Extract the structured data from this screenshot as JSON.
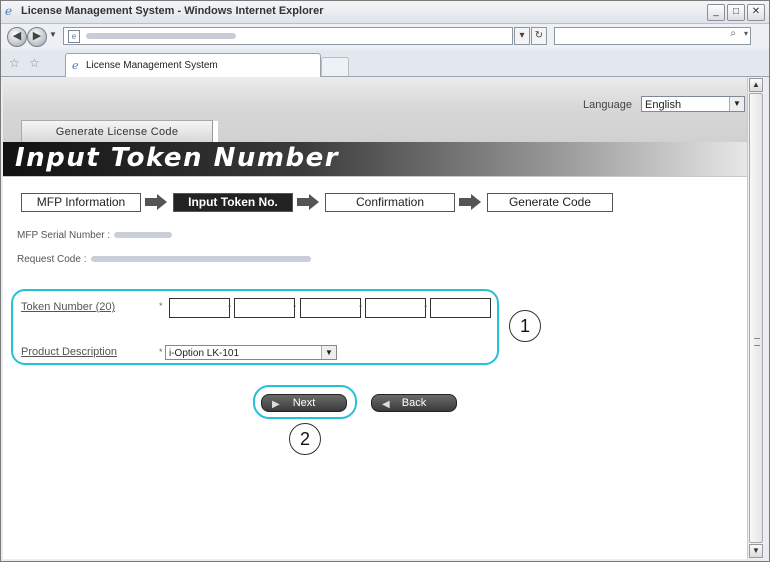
{
  "window": {
    "title": "License Management System - Windows Internet Explorer",
    "min_glyph": "_",
    "max_glyph": "□",
    "close_glyph": "✕"
  },
  "browser": {
    "address_value": "",
    "tab_label": "License Management System",
    "search_value": ""
  },
  "header": {
    "language_label": "Language",
    "language_value": "English",
    "menu_tab": "Generate License Code",
    "page_title": "Input Token Number"
  },
  "steps": [
    {
      "label": "MFP Information",
      "active": false
    },
    {
      "label": "Input Token No.",
      "active": true
    },
    {
      "label": "Confirmation",
      "active": false
    },
    {
      "label": "Generate Code",
      "active": false
    }
  ],
  "info": {
    "serial_label": "MFP Serial Number :",
    "request_label": "Request Code :"
  },
  "form": {
    "token_label": "Token Number (20)",
    "required_mark": "*",
    "token_fields": [
      "",
      "",
      "",
      "",
      ""
    ],
    "token_separator": "-",
    "product_label": "Product Description",
    "product_value": "i-Option LK-101"
  },
  "buttons": {
    "next_label": "Next",
    "back_label": "Back"
  },
  "callouts": {
    "one": "1",
    "two": "2"
  },
  "colors": {
    "callout": "#25c1d8",
    "title_dark": "#111111",
    "button_dark": "#3a3a3a"
  },
  "icons": [
    "ie-logo-icon",
    "back-arrow-icon",
    "forward-arrow-icon",
    "refresh-icon",
    "stop-icon",
    "search-icon",
    "favorites-star-icon",
    "add-favorites-icon",
    "step-arrow-icon"
  ]
}
